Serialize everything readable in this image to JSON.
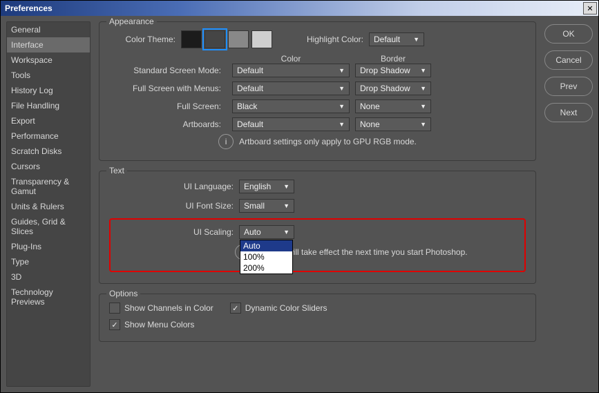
{
  "window": {
    "title": "Preferences"
  },
  "sidebar": {
    "items": [
      "General",
      "Interface",
      "Workspace",
      "Tools",
      "History Log",
      "File Handling",
      "Export",
      "Performance",
      "Scratch Disks",
      "Cursors",
      "Transparency & Gamut",
      "Units & Rulers",
      "Guides, Grid & Slices",
      "Plug-Ins",
      "Type",
      "3D",
      "Technology Previews"
    ],
    "active": 1
  },
  "appearance": {
    "legend": "Appearance",
    "color_theme_lbl": "Color Theme:",
    "swatch_colors": [
      "#1b1b1b",
      "#454545",
      "#888888",
      "#cfcfcf"
    ],
    "swatch_selected": 1,
    "highlight_lbl": "Highlight Color:",
    "highlight_val": "Default",
    "col_color": "Color",
    "col_border": "Border",
    "rows": [
      {
        "label": "Standard Screen Mode:",
        "color": "Default",
        "border": "Drop Shadow"
      },
      {
        "label": "Full Screen with Menus:",
        "color": "Default",
        "border": "Drop Shadow"
      },
      {
        "label": "Full Screen:",
        "color": "Black",
        "border": "None"
      },
      {
        "label": "Artboards:",
        "color": "Default",
        "border": "None"
      }
    ],
    "note": "Artboard settings only apply to GPU RGB mode."
  },
  "text": {
    "legend": "Text",
    "lang_lbl": "UI Language:",
    "lang_val": "English",
    "fontsize_lbl": "UI Font Size:",
    "fontsize_val": "Small",
    "scaling_lbl": "UI Scaling:",
    "scaling_val": "Auto",
    "scaling_opts": [
      "Auto",
      "100%",
      "200%"
    ],
    "note": "will take effect the next time you start Photoshop."
  },
  "options": {
    "legend": "Options",
    "channels": {
      "label": "Show Channels in Color",
      "checked": false
    },
    "sliders": {
      "label": "Dynamic Color Sliders",
      "checked": true
    },
    "menucolors": {
      "label": "Show Menu Colors",
      "checked": true
    }
  },
  "buttons": {
    "ok": "OK",
    "cancel": "Cancel",
    "prev": "Prev",
    "next": "Next"
  }
}
